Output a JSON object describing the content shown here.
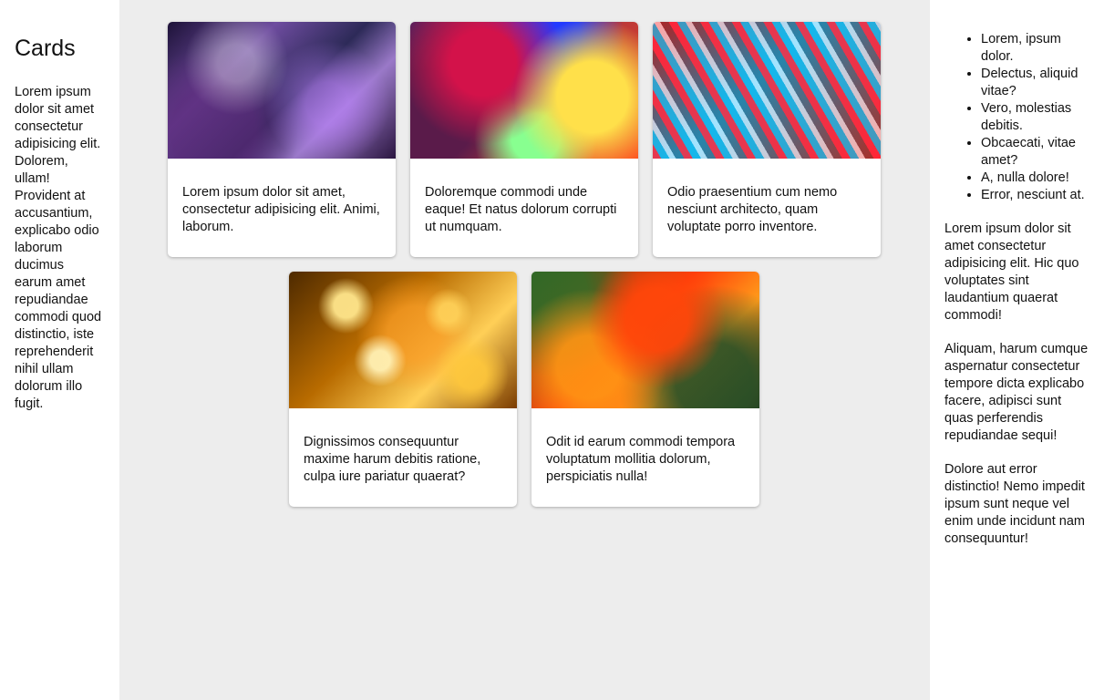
{
  "left": {
    "title": "Cards",
    "paragraph": "Lorem ipsum dolor sit amet consectetur adipisicing elit. Dolorem, ullam! Provident at accusantium, explicabo odio laborum ducimus earum amet repudiandae commodi quod distinctio, iste reprehenderit nihil ullam dolorum illo fugit."
  },
  "cards": [
    {
      "text": "Lorem ipsum dolor sit amet, consectetur adipisicing elit. Animi, laborum."
    },
    {
      "text": "Doloremque commodi unde eaque! Et natus dolorum corrupti ut numquam."
    },
    {
      "text": "Odio praesentium cum nemo nesciunt architecto, quam voluptate porro inventore."
    },
    {
      "text": "Dignissimos consequuntur maxime harum debitis ratione, culpa iure pariatur quaerat?"
    },
    {
      "text": "Odit id earum commodi tempora voluptatum mollitia dolorum, perspiciatis nulla!"
    }
  ],
  "right": {
    "list": [
      "Lorem, ipsum dolor.",
      "Delectus, aliquid vitae?",
      "Vero, molestias debitis.",
      "Obcaecati, vitae amet?",
      "A, nulla dolore!",
      "Error, nesciunt at."
    ],
    "paragraphs": [
      "Lorem ipsum dolor sit amet consectetur adipisicing elit. Hic quo voluptates sint laudantium quaerat commodi!",
      "Aliquam, harum cumque aspernatur consectetur tempore dicta explicabo facere, adipisci sunt quas perferendis repudiandae sequi!",
      "Dolore aut error distinctio! Nemo impedit ipsum sunt neque vel enim unde incidunt nam consequuntur!"
    ]
  }
}
